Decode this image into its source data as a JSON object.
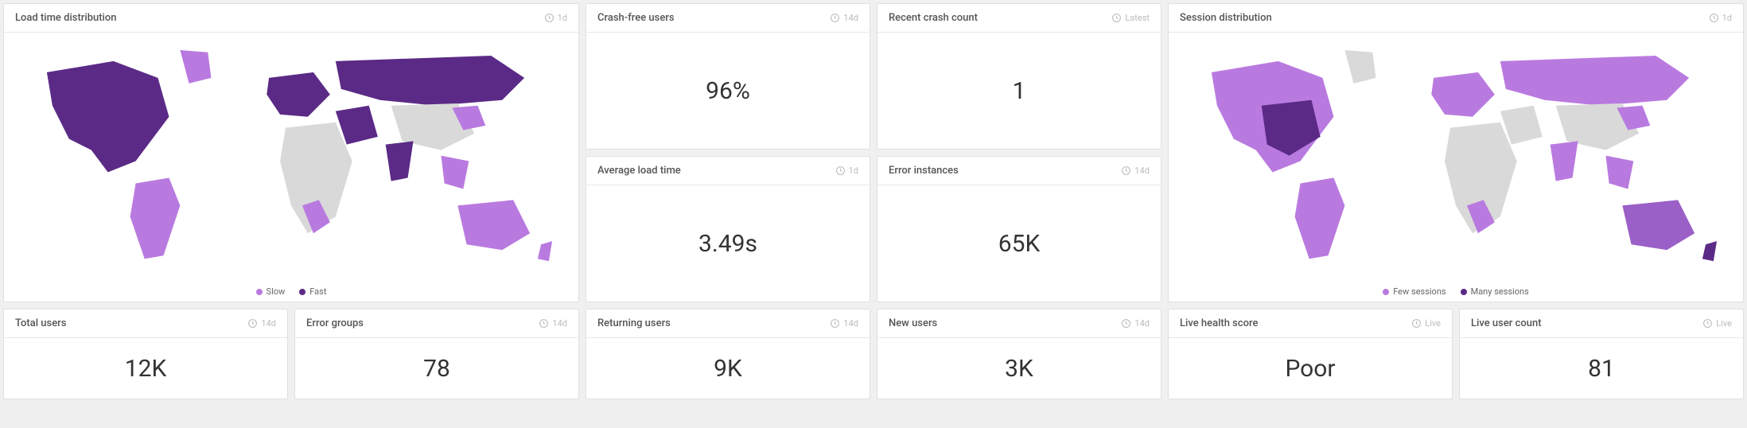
{
  "colors": {
    "light_purple": "#b97ae0",
    "dark_purple": "#5b2a86",
    "land_grey": "#d9d9d9"
  },
  "cards": {
    "load_time_map": {
      "title": "Load time distribution",
      "period": "1d",
      "legend": {
        "a": "Slow",
        "b": "Fast"
      }
    },
    "crash_free_users": {
      "title": "Crash-free users",
      "period": "14d",
      "value": "96%"
    },
    "recent_crash_count": {
      "title": "Recent crash count",
      "period": "Latest",
      "value": "1"
    },
    "avg_load_time": {
      "title": "Average load time",
      "period": "1d",
      "value": "3.49s"
    },
    "error_instances": {
      "title": "Error instances",
      "period": "14d",
      "value": "65K"
    },
    "session_map": {
      "title": "Session distribution",
      "period": "1d",
      "legend": {
        "a": "Few sessions",
        "b": "Many sessions"
      }
    },
    "total_users": {
      "title": "Total users",
      "period": "14d",
      "value": "12K"
    },
    "error_groups": {
      "title": "Error groups",
      "period": "14d",
      "value": "78"
    },
    "returning_users": {
      "title": "Returning users",
      "period": "14d",
      "value": "9K"
    },
    "new_users": {
      "title": "New users",
      "period": "14d",
      "value": "3K"
    },
    "live_health": {
      "title": "Live health score",
      "period": "Live",
      "value": "Poor"
    },
    "live_users": {
      "title": "Live user count",
      "period": "Live",
      "value": "81"
    }
  }
}
